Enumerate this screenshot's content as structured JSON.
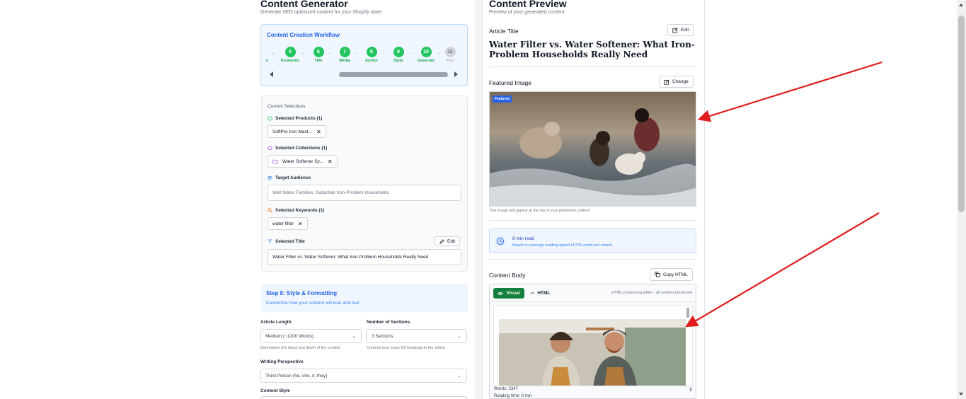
{
  "generator": {
    "title": "Content Generator",
    "subtitle": "Generate SEO optimized content for your Shopify store",
    "workflow": {
      "title": "Content Creation Workflow",
      "partial_label": "s",
      "steps": [
        {
          "num": "5",
          "label": "Keywords"
        },
        {
          "num": "6",
          "label": "Title"
        },
        {
          "num": "7",
          "label": "Media"
        },
        {
          "num": "8",
          "label": "Author"
        },
        {
          "num": "9",
          "label": "Style"
        },
        {
          "num": "10",
          "label": "Generate"
        },
        {
          "num": "11",
          "label": "Post"
        }
      ]
    },
    "selections": {
      "title": "Current Selections",
      "products_label": "Selected Products (1)",
      "product_chip": "SoftPro Iron Mast...",
      "collections_label": "Selected Collections (1)",
      "collection_chip": "Water Softener Sy...",
      "audience_label": "Target Audience",
      "audience_value": "Well Water Families, Suburban Iron-Problem Households",
      "keywords_label": "Selected Keywords (1)",
      "keyword_chip": "water filter",
      "title_label": "Selected Title",
      "edit_label": "Edit",
      "title_value": "Water Filter vs. Water Softener: What Iron-Problem Households Really Need"
    },
    "step8": {
      "title": "Step 8: Style & Formatting",
      "subtitle": "Customize how your content will look and feel"
    },
    "form": {
      "length_label": "Article Length",
      "length_value": "Medium (~1200 Words)",
      "length_help": "Determines the detail and depth of the content",
      "sections_label": "Number of Sections",
      "sections_value": "3 Sections",
      "sections_help": "Controls how many H2 headings in the article",
      "perspective_label": "Writing Perspective",
      "perspective_value": "Third Person (he, she, it, they)",
      "style_label": "Content Style"
    }
  },
  "preview": {
    "title": "Content Preview",
    "subtitle": "Preview of your generated content",
    "article_title_label": "Article Title",
    "edit_label": "Edit",
    "article_title": "Water Filter vs. Water Softener: What Iron-Problem Households Really Need",
    "featured_label": "Featured Image",
    "change_label": "Change",
    "featured_badge": "Featured",
    "image_note": "This image will appear at the top of your published content",
    "reading_time": "8 min read",
    "reading_note": "Based on average reading speed of 225 words per minute",
    "body_label": "Content Body",
    "copy_html_label": "Copy HTML",
    "tab_visual": "Visual",
    "tab_html": "HTML",
    "editor_note": "HTML-preserving editor - all content preserved",
    "words_label": "Words: 2347",
    "reading_label": "Reading time: 8 min"
  },
  "colors": {
    "green": "#22c55e",
    "blue": "#2563eb",
    "arrow": "#e11d1d"
  }
}
